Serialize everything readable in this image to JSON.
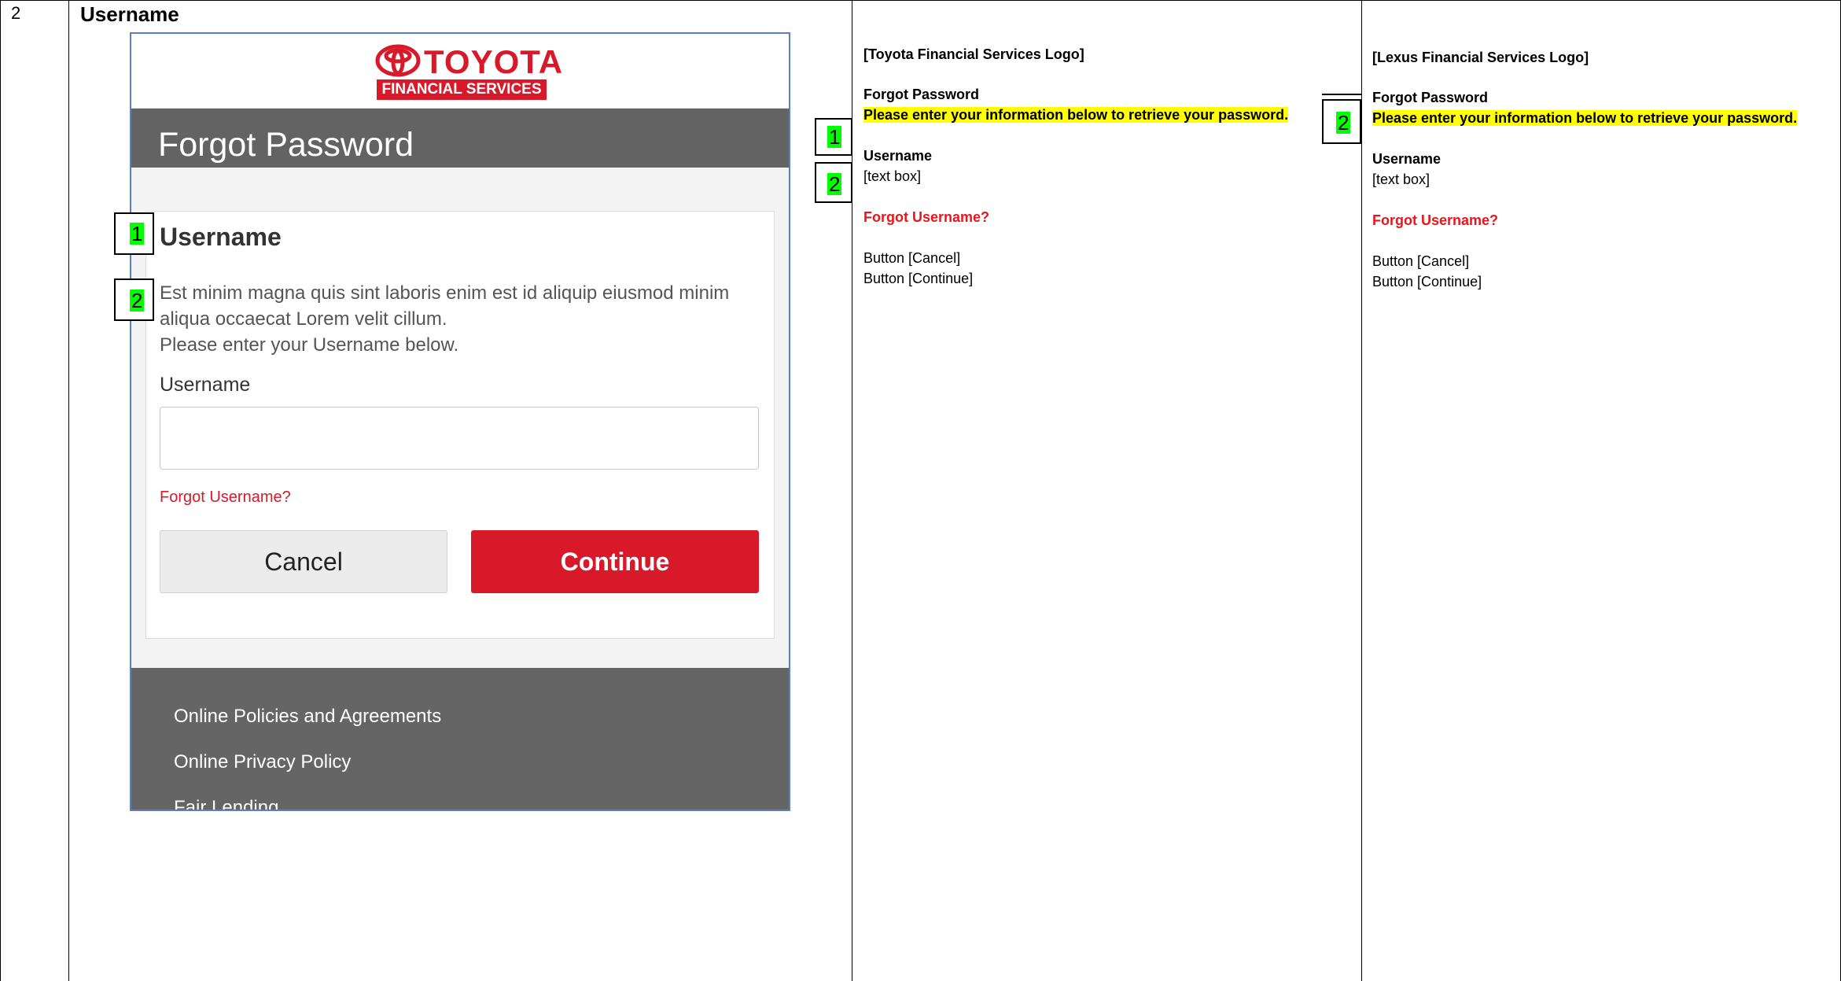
{
  "table": {
    "row_number": "2",
    "row_title": "Username"
  },
  "mockup": {
    "logo": {
      "brand": "TOYOTA",
      "subtitle": "FINANCIAL SERVICES"
    },
    "header_title": "Forgot Password",
    "card": {
      "heading": "Username",
      "body_line1": "Est minim magna quis sint laboris enim est id aliquip eiusmod minim",
      "body_line2": "aliqua occaecat Lorem velit cillum.",
      "body_line3": "Please enter your Username below.",
      "field_label": "Username",
      "input_value": "",
      "forgot_link": "Forgot Username?",
      "cancel_label": "Cancel",
      "continue_label": "Continue"
    },
    "footer_links": [
      "Online Policies and Agreements",
      "Online Privacy Policy",
      "Fair Lending"
    ],
    "markers": [
      "1",
      "2"
    ]
  },
  "toyota_spec": {
    "logo": "[Toyota Financial Services Logo]",
    "title": "Forgot Password",
    "instruction": "Please enter your information below to retrieve your password.",
    "field_label": "Username",
    "field_value": "[text box]",
    "link": "Forgot Username?",
    "button1": "Button [Cancel]",
    "button2": "Button [Continue]",
    "markers": [
      "1",
      "2"
    ]
  },
  "lexus_spec": {
    "logo": "[Lexus Financial Services Logo]",
    "title": "Forgot Password",
    "instruction": "Please enter your information below to retrieve your password.",
    "field_label": "Username",
    "field_value": "[text box]",
    "link": "Forgot Username?",
    "button1": "Button [Cancel]",
    "button2": "Button [Continue]",
    "markers": [
      "2"
    ]
  },
  "colors": {
    "brand_red": "#d7192a",
    "header_gray": "#636363",
    "marker_green": "#00ff00",
    "highlight_yellow": "#ffff00"
  }
}
